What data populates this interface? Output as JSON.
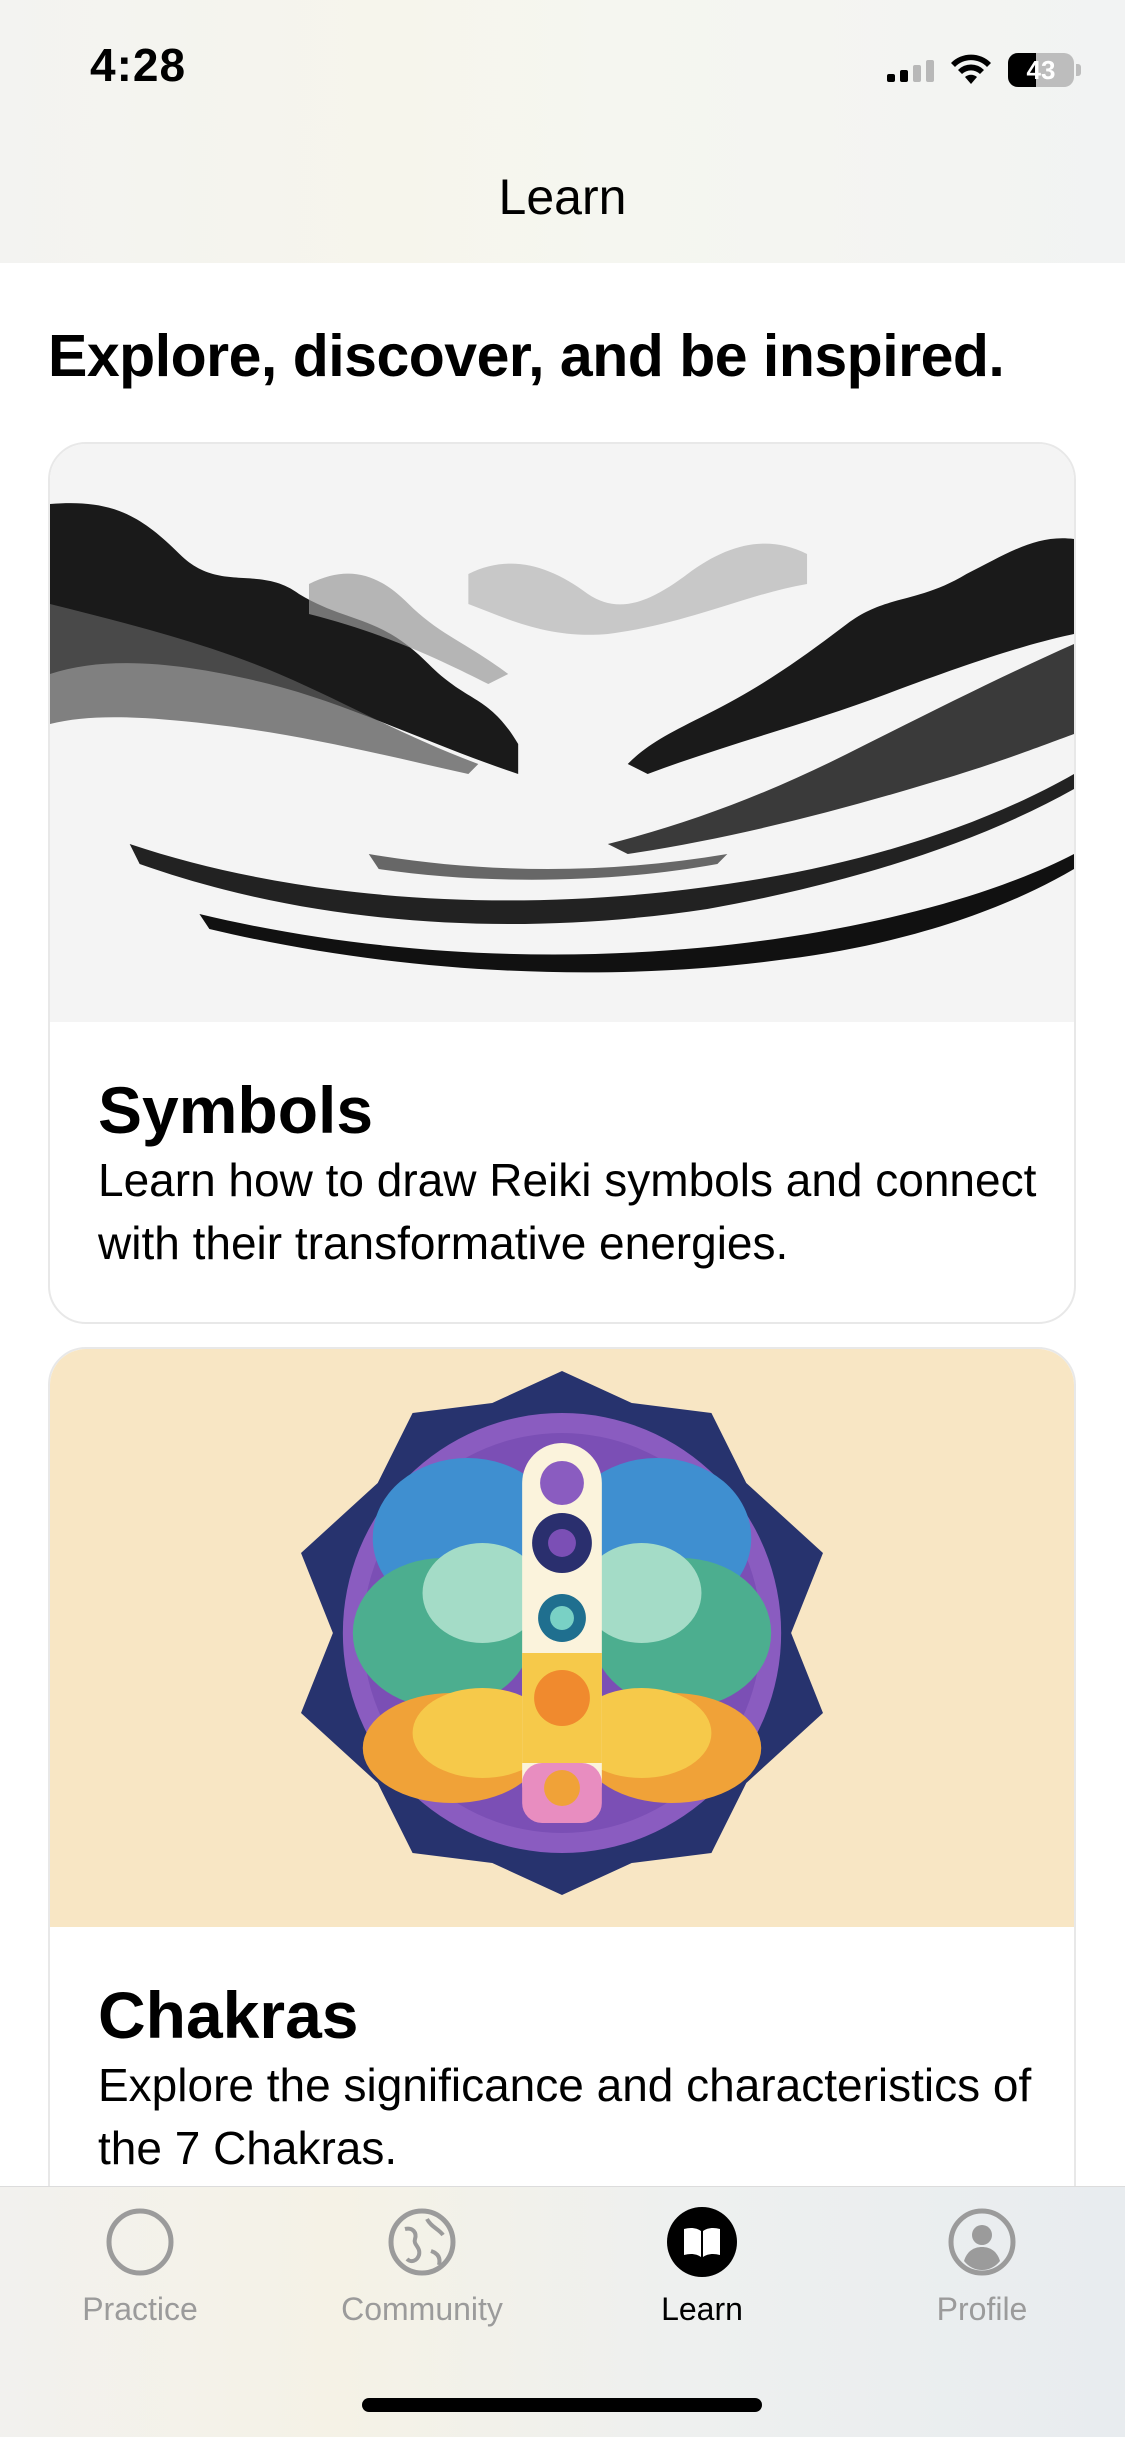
{
  "status_bar": {
    "time": "4:28",
    "battery": "43",
    "battery_level": 0.43
  },
  "nav": {
    "title": "Learn"
  },
  "headline": "Explore, discover, and be inspired.",
  "cards": [
    {
      "title": "Symbols",
      "description": "Learn how to draw Reiki symbols and connect with their transformative energies.",
      "image": "ink-mountains"
    },
    {
      "title": "Chakras",
      "description": "Explore the significance and characteristics of the 7 Chakras.",
      "image": "chakra-mandala"
    }
  ],
  "tabs": [
    {
      "label": "Practice",
      "icon": "circle-icon",
      "active": false
    },
    {
      "label": "Community",
      "icon": "globe-icon",
      "active": false
    },
    {
      "label": "Learn",
      "icon": "book-icon",
      "active": true
    },
    {
      "label": "Profile",
      "icon": "person-icon",
      "active": false
    }
  ],
  "colors": {
    "chakra_bg": "#f8e6c4",
    "inactive_tab": "#9b9b9b",
    "active_tab": "#000000"
  }
}
